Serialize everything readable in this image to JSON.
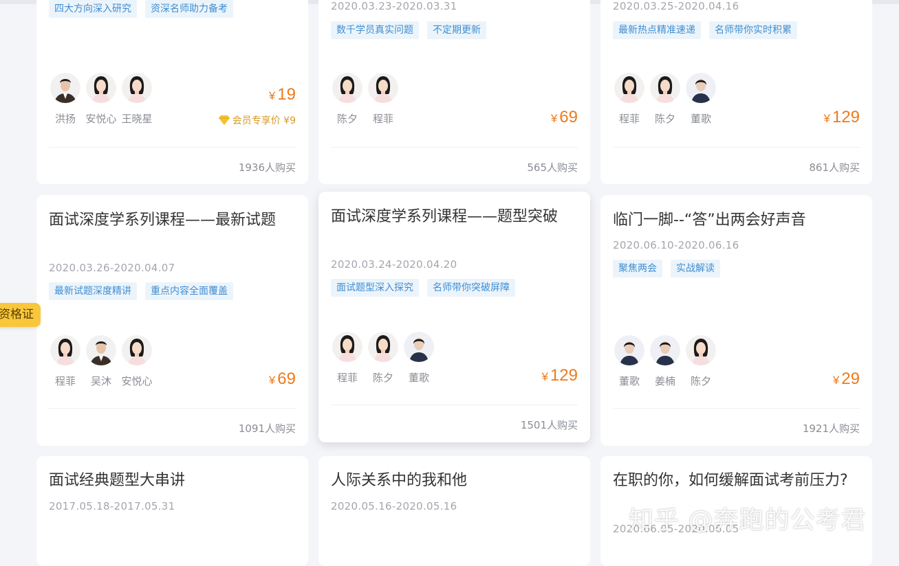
{
  "side_badge": "资格证",
  "watermark": "知乎 @奔跑的公考君",
  "row1": [
    {
      "tags": [
        "四大方向深入研究",
        "资深名师助力备考"
      ],
      "teachers": [
        "洪扬",
        "安悦心",
        "王晓星"
      ],
      "price": "19",
      "member_price": "会员专享价 ¥9",
      "buyers": "1936人购买"
    },
    {
      "date": "2020.03.23-2020.03.31",
      "tags": [
        "数千学员真实问题",
        "不定期更新"
      ],
      "teachers": [
        "陈夕",
        "程菲"
      ],
      "price": "69",
      "buyers": "565人购买"
    },
    {
      "date": "2020.03.25-2020.04.16",
      "tags": [
        "最新热点精准速递",
        "名师带你实时积累"
      ],
      "teachers": [
        "程菲",
        "陈夕",
        "董歌"
      ],
      "price": "129",
      "buyers": "861人购买"
    }
  ],
  "row2": [
    {
      "title": "面试深度学系列课程——最新试题",
      "date": "2020.03.26-2020.04.07",
      "tags": [
        "最新试题深度精讲",
        "重点内容全面覆盖"
      ],
      "teachers": [
        "程菲",
        "吴沐",
        "安悦心"
      ],
      "price": "69",
      "buyers": "1091人购买"
    },
    {
      "title": "面试深度学系列课程——题型突破",
      "date": "2020.03.24-2020.04.20",
      "tags": [
        "面试题型深入探究",
        "名师带你突破屏障"
      ],
      "teachers": [
        "程菲",
        "陈夕",
        "董歌"
      ],
      "price": "129",
      "buyers": "1501人购买"
    },
    {
      "title": "临门一脚--“答”出两会好声音",
      "date": "2020.06.10-2020.06.16",
      "tags": [
        "聚焦两会",
        "实战解读"
      ],
      "teachers": [
        "董歌",
        "姜楠",
        "陈夕"
      ],
      "price": "29",
      "buyers": "1921人购买"
    }
  ],
  "row3": [
    {
      "title": "面试经典题型大串讲",
      "date": "2017.05.18-2017.05.31"
    },
    {
      "title": "人际关系中的我和他",
      "date": "2020.05.16-2020.05.16"
    },
    {
      "title": "在职的你，如何缓解面试考前压力?",
      "date": "2020.06.05-2020.06.05"
    }
  ],
  "currency": "¥",
  "colors": {
    "price": "#ee7a1a",
    "tag_text": "#3f8ed1",
    "tag_bg": "#ecf4fb",
    "badge": "#f9c73b"
  }
}
